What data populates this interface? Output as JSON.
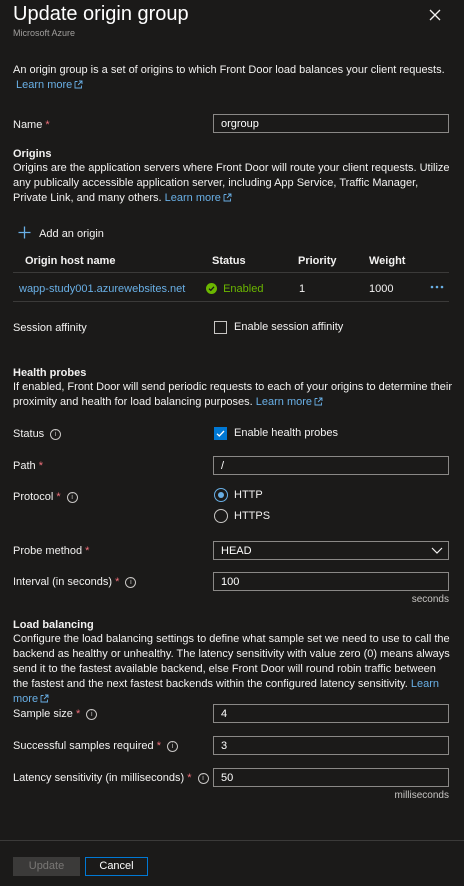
{
  "header": {
    "title": "Update origin group",
    "subtitle": "Microsoft Azure"
  },
  "intro": {
    "text": "An origin group is a set of origins to which Front Door load balances your client requests.",
    "learn_more": "Learn more"
  },
  "name": {
    "label": "Name",
    "value": "orgroup"
  },
  "origins": {
    "heading": "Origins",
    "description": "Origins are the application servers where Front Door will route your client requests. Utilize any publically accessible application server, including App Service, Traffic Manager, Private Link, and many others.",
    "learn_more": "Learn more",
    "add_label": "Add an origin",
    "columns": [
      "Origin host name",
      "Status",
      "Priority",
      "Weight"
    ],
    "rows": [
      {
        "host": "wapp-study001.azurewebsites.net",
        "status": "Enabled",
        "priority": "1",
        "weight": "1000"
      }
    ]
  },
  "session_affinity": {
    "label": "Session affinity",
    "checkbox_label": "Enable session affinity",
    "checked": false
  },
  "health_probes": {
    "heading": "Health probes",
    "description": "If enabled, Front Door will send periodic requests to each of your origins to determine their proximity and health for load balancing purposes.",
    "learn_more": "Learn more",
    "status_label": "Status",
    "status_checkbox_label": "Enable health probes",
    "status_checked": true,
    "path_label": "Path",
    "path_value": "/",
    "protocol_label": "Protocol",
    "protocol_options": [
      "HTTP",
      "HTTPS"
    ],
    "protocol_selected": "HTTP",
    "method_label": "Probe method",
    "method_value": "HEAD",
    "interval_label": "Interval (in seconds)",
    "interval_value": "100",
    "interval_unit": "seconds"
  },
  "load_balancing": {
    "heading": "Load balancing",
    "description": "Configure the load balancing settings to define what sample set we need to use to call the backend as healthy or unhealthy. The latency sensitivity with value zero (0) means always send it to the fastest available backend, else Front Door will round robin traffic between the fastest and the next fastest backends within the configured latency sensitivity.",
    "learn_more": "Learn more",
    "sample_size_label": "Sample size",
    "sample_size_value": "4",
    "successful_label": "Successful samples required",
    "successful_value": "3",
    "latency_label": "Latency sensitivity (in milliseconds)",
    "latency_value": "50",
    "latency_unit": "milliseconds"
  },
  "footer": {
    "update_label": "Update",
    "cancel_label": "Cancel"
  },
  "colors": {
    "background": "#1b1a19",
    "link": "#69afe5",
    "primary": "#0078d4",
    "enabled": "#6bb700",
    "required": "#f1707b"
  }
}
